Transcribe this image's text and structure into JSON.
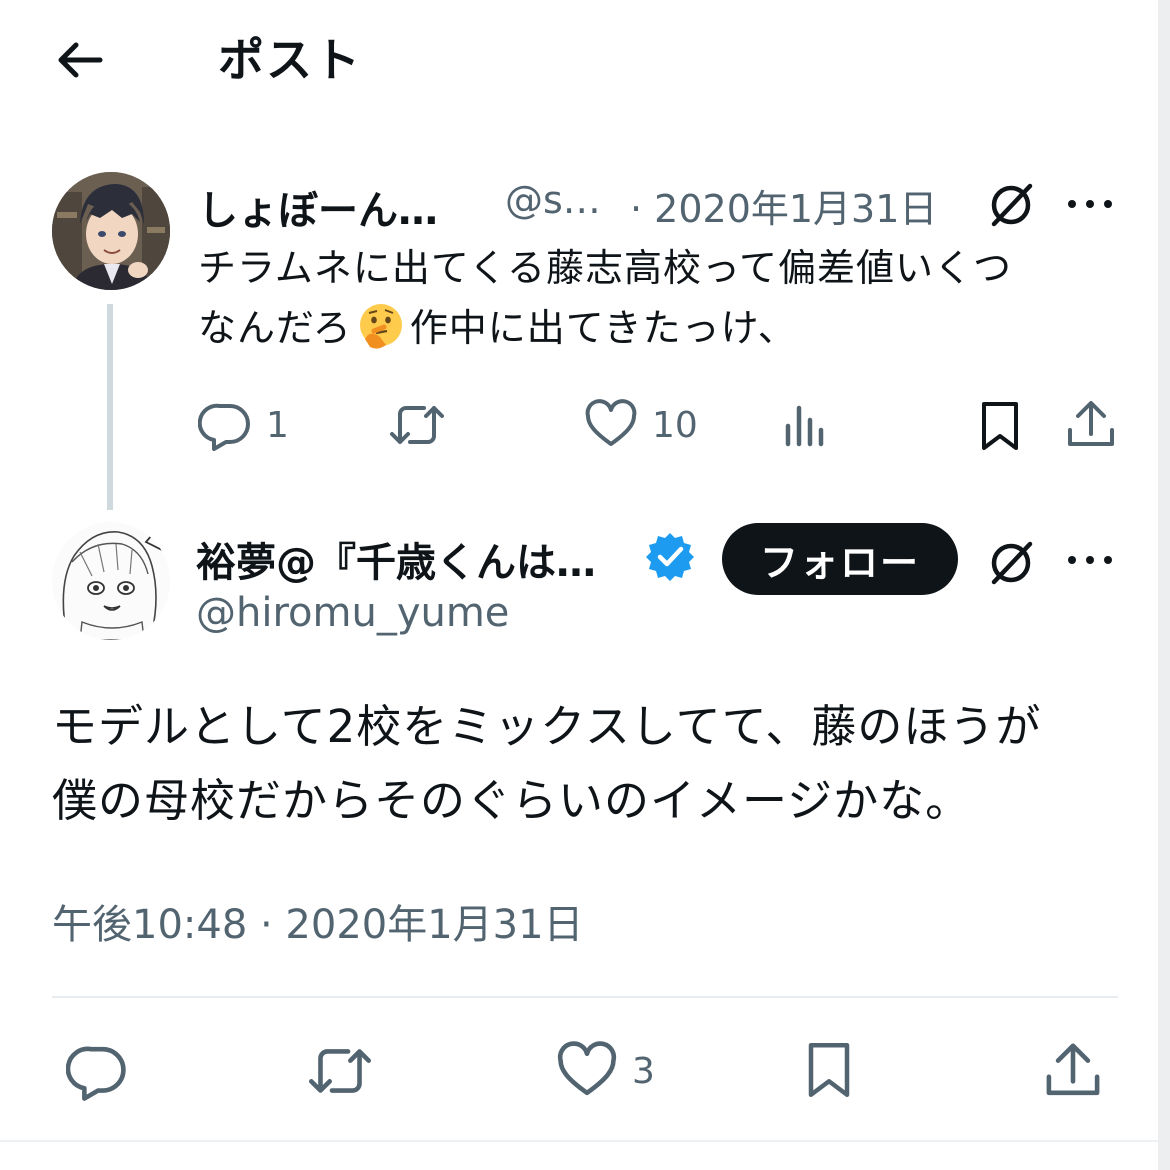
{
  "header": {
    "title": "ポスト",
    "back_icon": "arrow-left-icon"
  },
  "parent_tweet": {
    "display_name": "しょぼーん…",
    "handle": "@s…",
    "date": "· 2020年1月31日",
    "body_lines": [
      "チラムネに出てくる藤志高校って偏差値いくつ",
      "なんだろ",
      "作中に出てきたっけ、"
    ],
    "emoji": "thinking-face",
    "replies": "1",
    "likes": "10"
  },
  "main_tweet": {
    "display_name": "裕夢@『千歳くんは…",
    "handle": "@hiromu_yume",
    "verified": true,
    "follow_label": "フォロー",
    "body_lines": [
      "モデルとして2校をミックスしてて、藤のほうが",
      "僕の母校だからそのぐらいのイメージかな。"
    ],
    "timestamp": "午後10:48 · 2020年1月31日",
    "likes": "3"
  },
  "colors": {
    "text": "#0f1419",
    "secondary": "#536471",
    "verified": "#1d9bf0",
    "thread_line": "#cfd9de"
  }
}
